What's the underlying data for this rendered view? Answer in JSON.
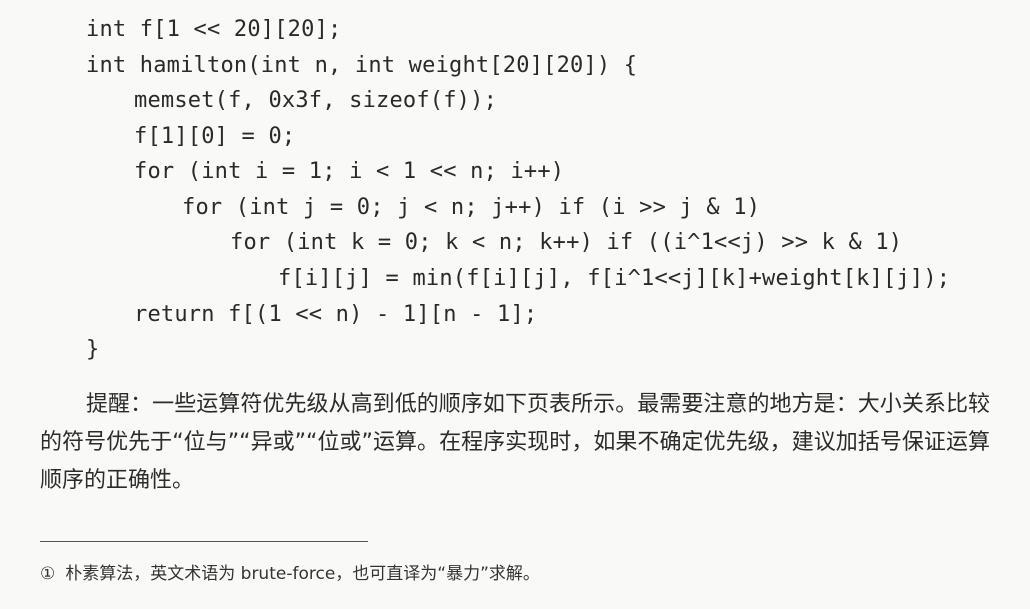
{
  "code": {
    "lines": [
      "int f[1 << 20][20];",
      "int hamilton(int n, int weight[20][20]) {",
      "memset(f, 0x3f, sizeof(f));",
      "f[1][0] = 0;",
      "for (int i = 1; i < 1 << n; i++)",
      "for (int j = 0; j < n; j++) if (i >> j & 1)",
      "for (int k = 0; k < n; k++) if ((i^1<<j) >> k & 1)",
      "f[i][j] = min(f[i][j], f[i^1<<j][k]+weight[k][j]);",
      "return f[(1 << n) - 1][n - 1];",
      "}"
    ]
  },
  "prose": {
    "paragraph": "提醒：一些运算符优先级从高到低的顺序如下页表所示。最需要注意的地方是：大小关系比较的符号优先于“位与”“异或”“位或”运算。在程序实现时，如果不确定优先级，建议加括号保证运算顺序的正确性。"
  },
  "footnote": {
    "marker": "①",
    "text": "朴素算法，英文术语为 brute-force，也可直译为“暴力”求解。"
  }
}
